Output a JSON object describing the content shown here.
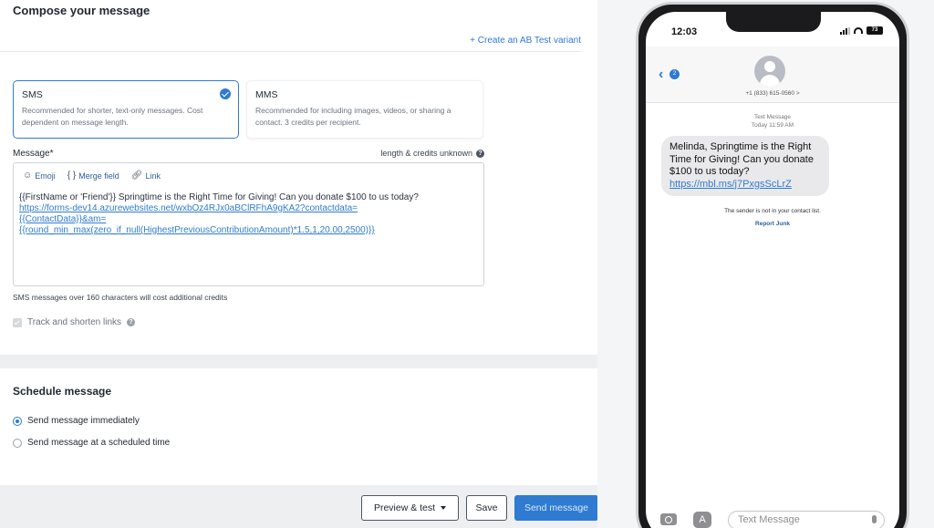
{
  "compose": {
    "title": "Compose your message",
    "ab_link": "+ Create an AB Test variant",
    "sms": {
      "title": "SMS",
      "desc": "Recommended for shorter, text-only messages. Cost dependent on message length."
    },
    "mms": {
      "title": "MMS",
      "desc": "Recommended for including images, videos, or sharing a contact. 3 credits per recipient."
    },
    "message_label": "Message*",
    "credits_note": "length & credits unknown",
    "toolbar": {
      "emoji": "Emoji",
      "merge": "Merge field",
      "link": "Link"
    },
    "body_text": "{{FirstName or 'Friend'}} Springtime is the Right Time for Giving! Can you donate $100 to us today?",
    "body_link_1": "https://forms-dev14.azurewebsites.net/wxbOz4RJx0aBClRFhA9gKA2?contactdata=",
    "body_link_2": "{{ContactData}}&am=",
    "body_link_3": "{{round_min_max(zero_if_null(HighestPreviousContributionAmount)*1.5,1,20.00,2500)}}",
    "sms_note": "SMS messages over 160 characters will cost additional credits",
    "track_label": "Track and shorten links"
  },
  "schedule": {
    "title": "Schedule message",
    "option_now": "Send message immediately",
    "option_later": "Send message at a scheduled time"
  },
  "buttons": {
    "preview": "Preview & test",
    "save": "Save",
    "send": "Send message"
  },
  "phone": {
    "time": "12:03",
    "battery": "73",
    "back_badge": "2",
    "contact": "+1 (833) 615-0560 >",
    "thread_label": "Text Message",
    "thread_time": "Today 11:59 AM",
    "bubble_text": "Melinda, Springtime is the Right Time for Giving! Can you donate $100 to us today?",
    "bubble_link": "https://mbl.ms/j7PxgsScLrZ",
    "sender_note": "The sender is not in your contact list.",
    "report_junk": "Report Junk",
    "input_placeholder": "Text Message"
  },
  "colors": {
    "accent": "#2f7bd1",
    "bubble": "#e9e9eb",
    "background": "#eeeff1"
  }
}
